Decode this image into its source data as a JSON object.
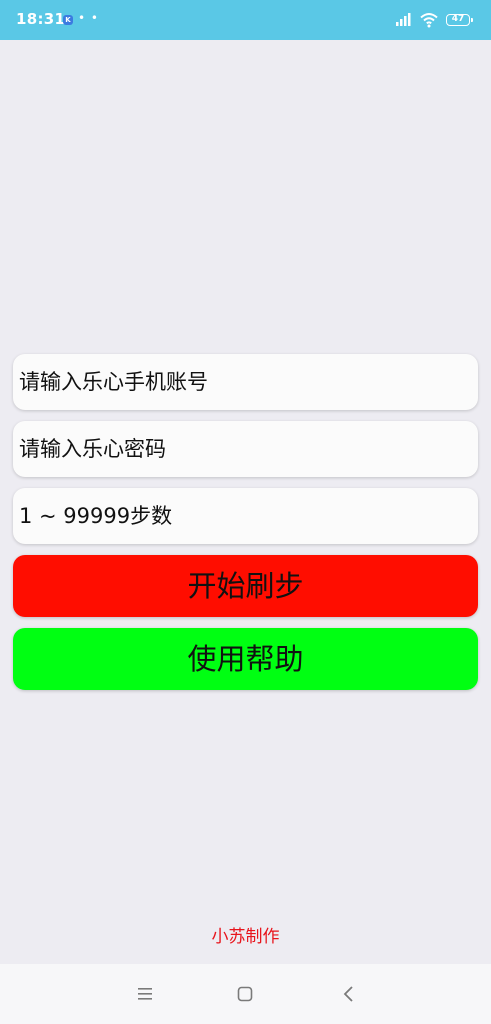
{
  "status_bar": {
    "time": "18:31",
    "app_badge": "K",
    "dots": "• •",
    "battery": "47",
    "bg_color": "#5ac8e6"
  },
  "form": {
    "phone_placeholder": "请输入乐心手机账号",
    "password_placeholder": "请输入乐心密码",
    "steps_placeholder": "1 ~ 99999步数"
  },
  "buttons": {
    "start_label": "开始刷步",
    "start_color": "#ff0d00",
    "help_label": "使用帮助",
    "help_color": "#00ff12"
  },
  "footer": {
    "credit": "小苏制作",
    "credit_color": "#e8141c"
  },
  "nav_bar": {
    "icons": [
      "menu-icon",
      "home-icon",
      "back-icon"
    ]
  }
}
